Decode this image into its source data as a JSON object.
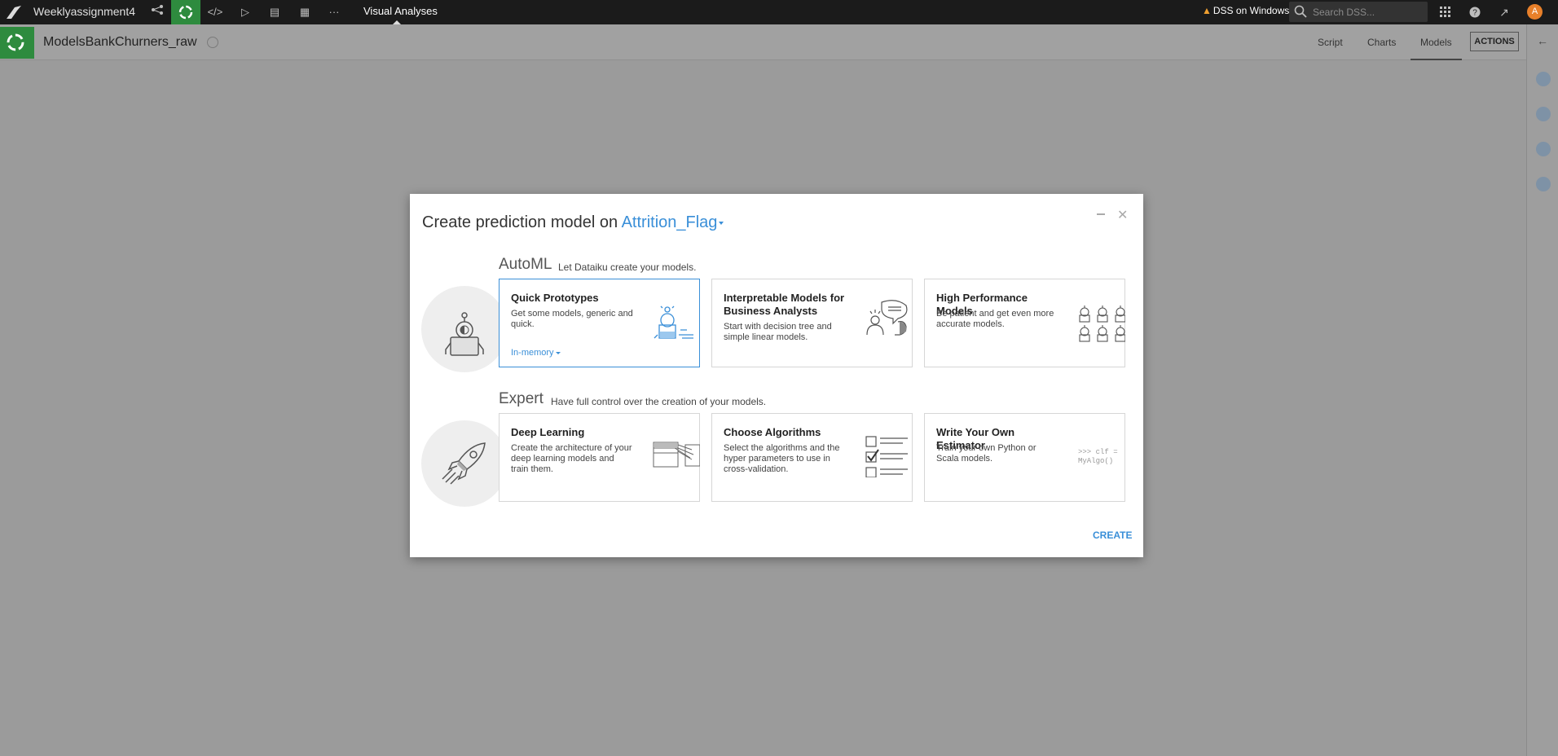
{
  "topnav": {
    "project_name": "Weeklyassignment4",
    "section": "Visual Analyses",
    "warning": "DSS on Windows",
    "search_placeholder": "Search DSS...",
    "avatar_letter": "A"
  },
  "header": {
    "title": "ModelsBankChurners_raw",
    "tabs": [
      "Script",
      "Charts",
      "Models"
    ],
    "active_tab": "Models",
    "actions_label": "ACTIONS"
  },
  "modal": {
    "title_prefix": "Create prediction model on ",
    "target": "Attrition_Flag",
    "automl": {
      "title": "AutoML",
      "subtitle": "Let Dataiku create your models.",
      "cards": [
        {
          "title": "Quick Prototypes",
          "desc": "Get some models, generic and quick.",
          "dropdown": "In-memory"
        },
        {
          "title": "Interpretable Models for Business Analysts",
          "desc": "Start with decision tree and simple linear models."
        },
        {
          "title": "High Performance Models",
          "desc": "Be patient and get even more accurate models."
        }
      ]
    },
    "expert": {
      "title": "Expert",
      "subtitle": "Have full control over the creation of your models.",
      "cards": [
        {
          "title": "Deep Learning",
          "desc": "Create the architecture of your deep learning models and train them."
        },
        {
          "title": "Choose Algorithms",
          "desc": "Select the algorithms and the hyper parameters to use in cross-validation."
        },
        {
          "title": "Write Your Own Estimator",
          "desc": "Train your own Python or Scala models.",
          "code": ">>> clf = MyAlgo()"
        }
      ]
    },
    "create_label": "CREATE"
  },
  "colors": {
    "accent": "#3a8fd8",
    "brand_green": "#2e8b3e",
    "overlay": "#9b9b9b"
  }
}
